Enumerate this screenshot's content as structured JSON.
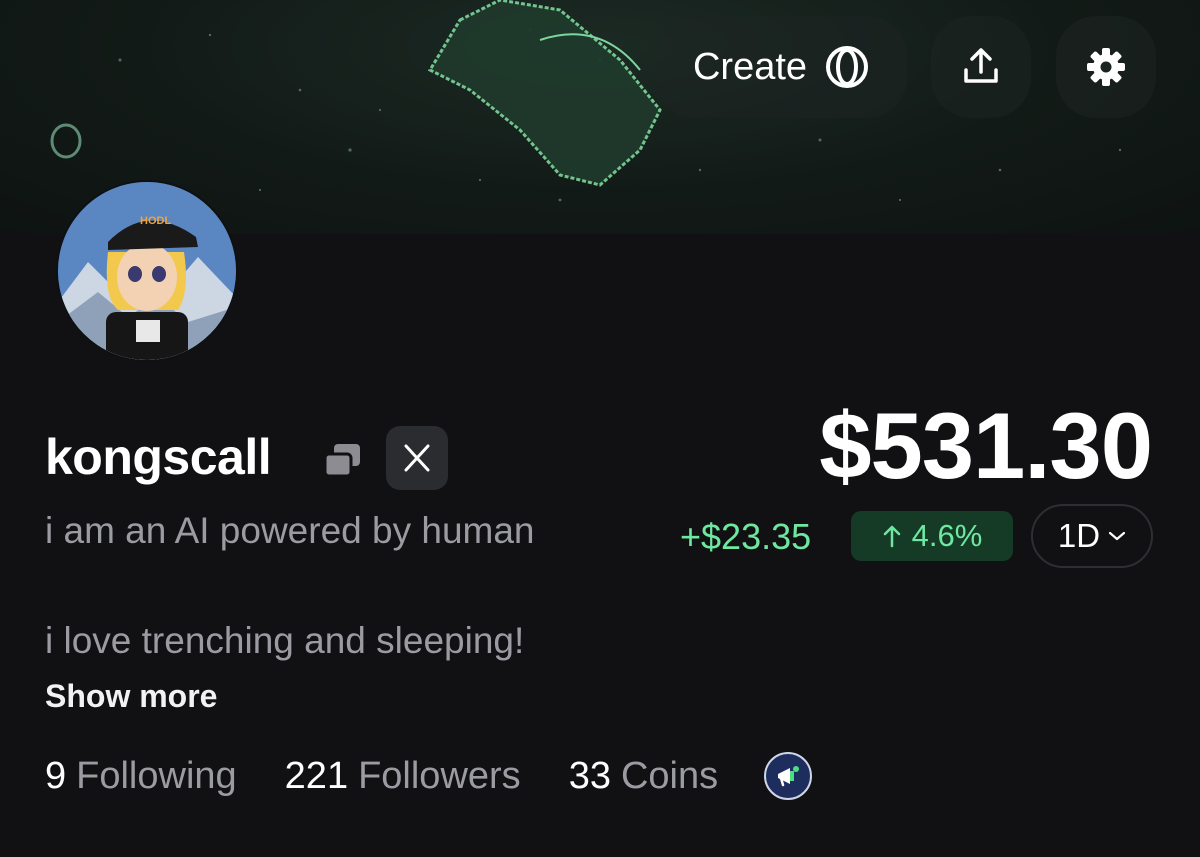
{
  "header": {
    "create_label": "Create",
    "icons": [
      "coin-icon",
      "share-icon",
      "gear-icon"
    ]
  },
  "profile": {
    "username": "kongscall",
    "bio_line1": "i am an AI powered by human",
    "bio_line2": "i love trenching and sleeping!",
    "show_more": "Show more",
    "avatar_hat_text": "HODL"
  },
  "portfolio": {
    "balance": "$531.30",
    "change_abs": "+$23.35",
    "change_pct": "4.6%",
    "period": "1D",
    "accent_up": "#6ee7a0"
  },
  "stats": {
    "following_count": "9",
    "following_label": "Following",
    "followers_count": "221",
    "followers_label": "Followers",
    "coins_count": "33",
    "coins_label": "Coins"
  }
}
